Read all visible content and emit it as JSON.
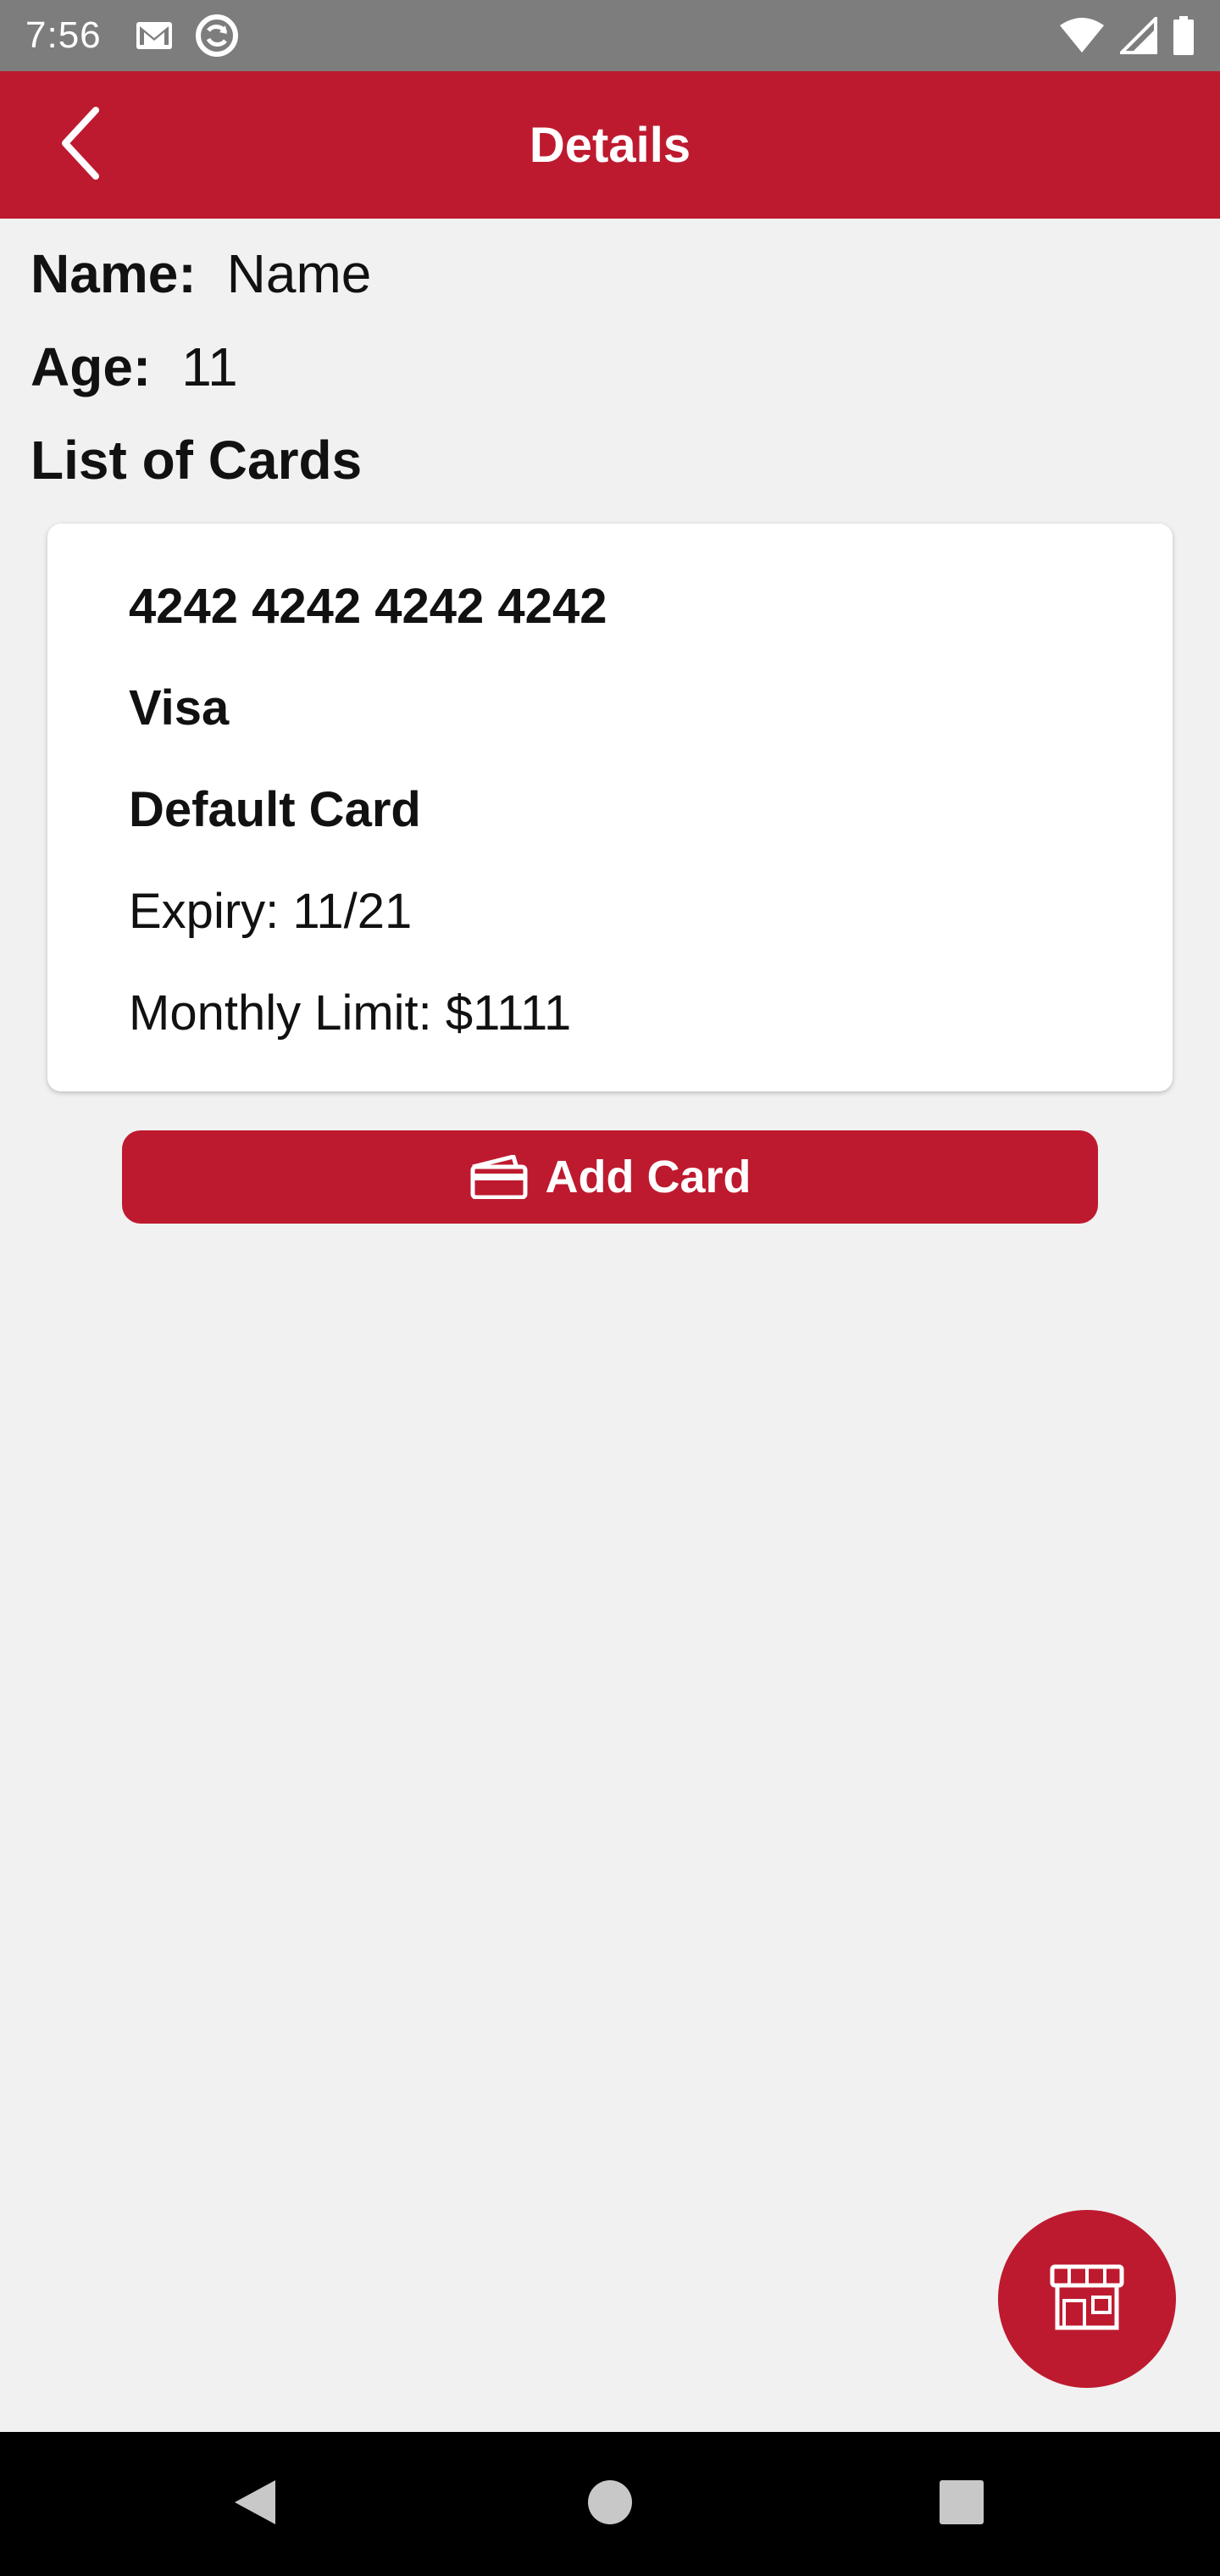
{
  "status_bar": {
    "time": "7:56",
    "icons_left": [
      "gmail-icon",
      "sync-icon"
    ],
    "icons_right": [
      "wifi-icon",
      "signal-icon",
      "battery-icon"
    ]
  },
  "app_bar": {
    "title": "Details",
    "back_icon": "chevron-left-icon",
    "color": "#be1a2f"
  },
  "details": {
    "name_label": "Name:",
    "name_value": "Name",
    "age_label": "Age:",
    "age_value": "11",
    "cards_heading": "List of Cards"
  },
  "cards": [
    {
      "number": "4242 4242 4242 4242",
      "brand": "Visa",
      "default_label": "Default Card",
      "expiry": "Expiry: 11/21",
      "monthly_limit": "Monthly Limit: $1111"
    }
  ],
  "add_card_button": {
    "label": "Add Card",
    "icon": "credit-card-icon"
  },
  "fab": {
    "icon": "store-icon"
  },
  "nav_bar": {
    "buttons": [
      "back-triangle-icon",
      "home-circle-icon",
      "recents-square-icon"
    ]
  }
}
